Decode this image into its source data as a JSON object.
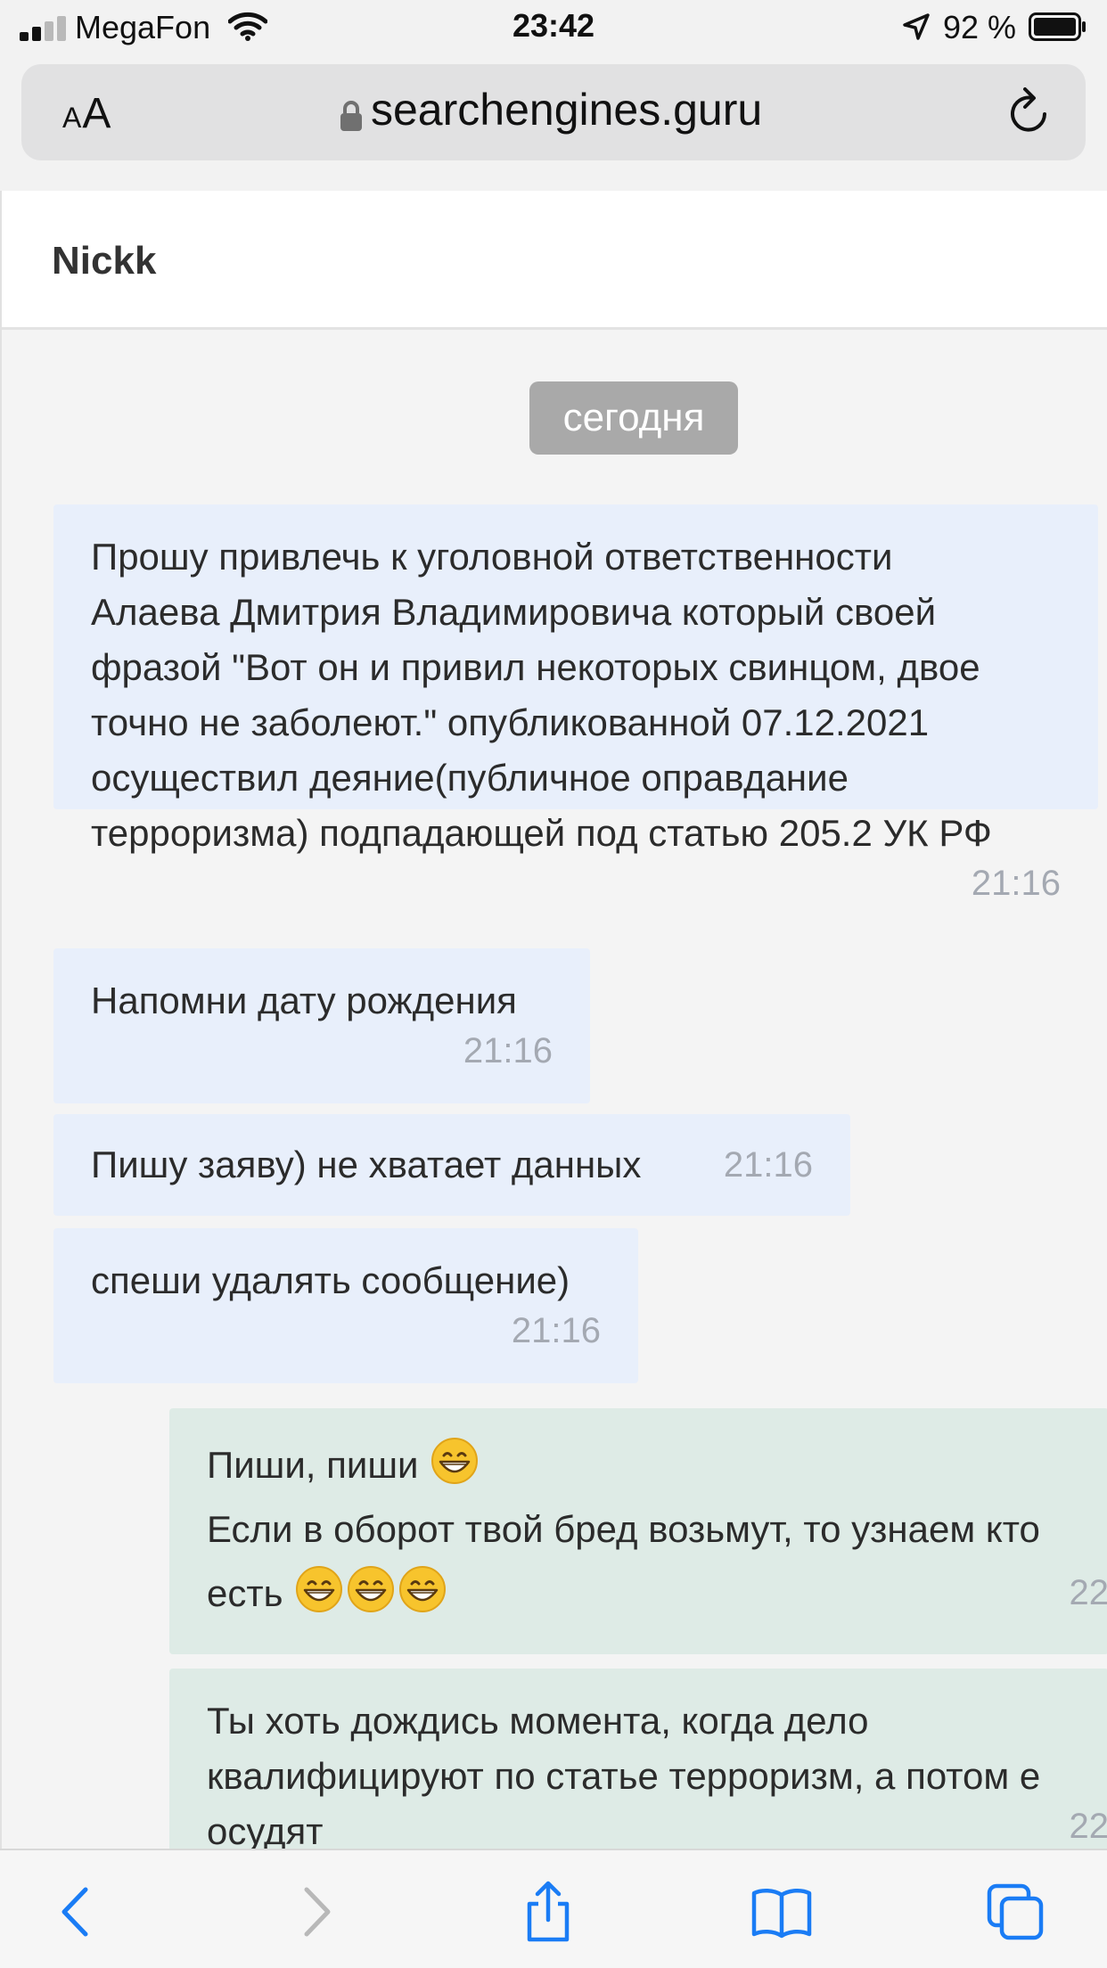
{
  "status_bar": {
    "carrier": "MegaFon",
    "time": "23:42",
    "battery": "92 %"
  },
  "browser": {
    "text_size_label": "AA",
    "domain": "searchengines.guru"
  },
  "chat": {
    "contact_name": "Nickk",
    "day_separator": "сегодня",
    "messages": [
      {
        "direction": "incoming",
        "lines": [
          "Прошу привлечь к уголовной ответственности",
          "Алаева Дмитрия Владимировича который своей",
          "фразой \"Вот он и привил некоторых свинцом, двое",
          "точно не заболеют.\" опубликованной 07.12.2021",
          "осуществил деяние(публичное оправдание",
          "терроризма) подпадающей под статью 205.2 УК РФ"
        ],
        "time": "21:16"
      },
      {
        "direction": "incoming",
        "lines": [
          "Напомни дату рождения"
        ],
        "time": "21:16"
      },
      {
        "direction": "incoming",
        "lines": [
          "Пишу заяву) не хватает данных"
        ],
        "time": "21:16"
      },
      {
        "direction": "incoming",
        "lines": [
          "спеши удалять сообщение)"
        ],
        "time": "21:16"
      },
      {
        "direction": "outgoing",
        "lines": [
          "Пиши, пиши",
          "Если в оборот твой бред возьмут, то узнаем кто",
          "есть"
        ],
        "time": "22"
      },
      {
        "direction": "outgoing",
        "lines": [
          "Ты хоть дождись момента, когда дело",
          "квалифицируют по статье терроризм, а потом е",
          "осудят"
        ],
        "time": "22"
      }
    ]
  },
  "icons": {
    "emoji": "grinning-face-emoji",
    "toolbar": [
      "back-icon",
      "forward-icon",
      "share-icon",
      "bookmarks-icon",
      "tabs-icon"
    ]
  },
  "colors": {
    "incoming_bubble": "#e8effb",
    "outgoing_bubble": "#deebe6",
    "day_pill": "#a9a9a9",
    "ios_blue": "#1a7cf5",
    "timestamp": "#a4a9b2"
  }
}
